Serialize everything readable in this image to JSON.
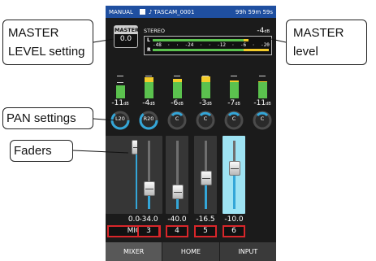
{
  "status_bar": {
    "mode": "MANUAL",
    "file_name": "TASCAM_0001",
    "remaining_time": "99h 59m 59s",
    "icons": [
      "checkbox-icon",
      "music-note-icon"
    ]
  },
  "master": {
    "label": "MASTER",
    "value": "0.0",
    "stereo_label": "STEREO",
    "peak_value": "-4",
    "peak_unit": "dB",
    "channel_labels": {
      "left": "L",
      "right": "R"
    },
    "scale": [
      "-48",
      "-24",
      "-12",
      "-6",
      "-20"
    ],
    "left_level": 0.82,
    "right_level": 0.99
  },
  "channels": [
    {
      "name": "MIC",
      "level_db": "-11",
      "pan": "L20",
      "fader": "0.0",
      "fader_level": 0.9,
      "meter_level": 0.5,
      "selected": false
    },
    {
      "name": "3",
      "level_db": "-4",
      "pan": "R20",
      "fader": "-34.0",
      "fader_level": 0.3,
      "meter_level": 0.8,
      "selected": false
    },
    {
      "name": "4",
      "level_db": "-6",
      "pan": "C",
      "fader": "-40.0",
      "fader_level": 0.25,
      "meter_level": 0.75,
      "selected": false
    },
    {
      "name": "5",
      "level_db": "-3",
      "pan": "C",
      "fader": "-16.5",
      "fader_level": 0.45,
      "meter_level": 0.85,
      "selected": false
    },
    {
      "name": "6",
      "level_db": "-7",
      "pan": "C",
      "fader": "-10.0",
      "fader_level": 0.6,
      "meter_level": 0.7,
      "selected": true
    }
  ],
  "extra_channel": {
    "level_db": "-11",
    "pan": "C",
    "meter_level": 0.65
  },
  "db_unit": "dB",
  "tabs": [
    "MIXER",
    "HOME",
    "INPUT"
  ],
  "callouts": {
    "master_setting_line1": "MASTER",
    "master_setting_line2": "LEVEL setting",
    "master_level_line1": "MASTER",
    "master_level_line2": "level",
    "pan": "PAN settings",
    "faders": "Faders"
  },
  "colors": {
    "status_bar": "#1f4fa0",
    "meter_green": "#5bc24e",
    "meter_yellow": "#f3cc2a",
    "fader_fill": "#34a6d8",
    "selected_fader": "#9ee3f3",
    "channel_border": "#d9262a"
  }
}
